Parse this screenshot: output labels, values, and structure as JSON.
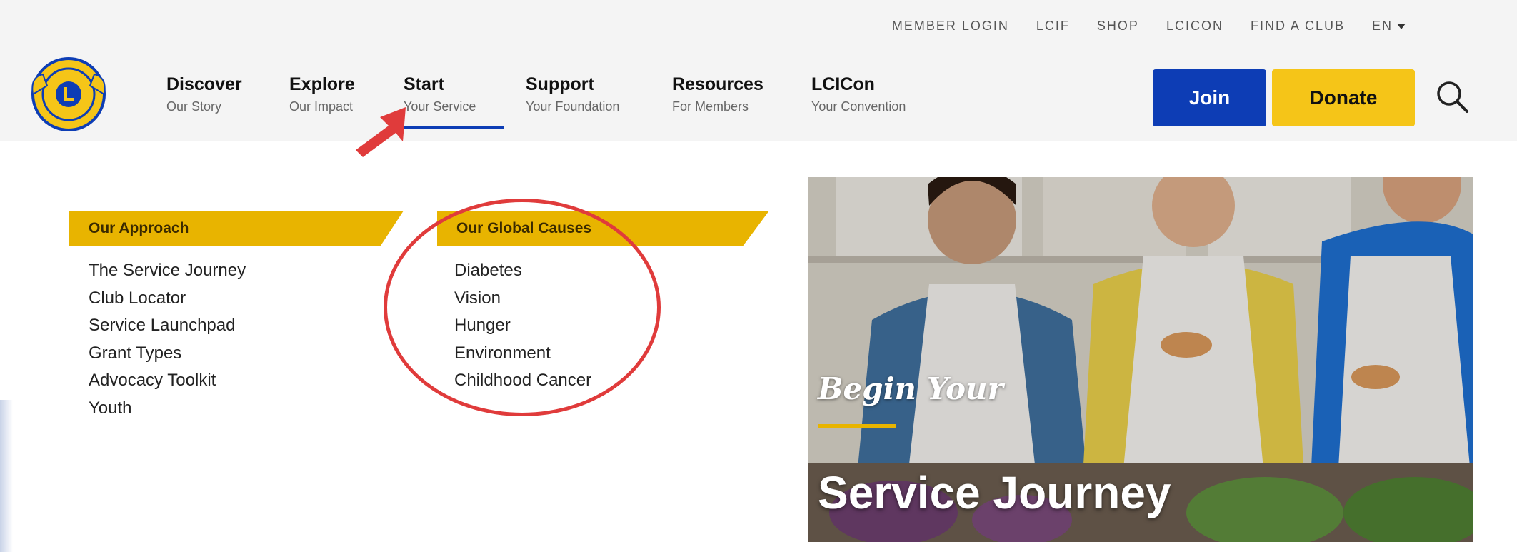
{
  "utility_nav": {
    "items": [
      "MEMBER LOGIN",
      "LCIF",
      "SHOP",
      "LCICON",
      "FIND A CLUB"
    ],
    "language": "EN"
  },
  "main_nav": [
    {
      "title": "Discover",
      "subtitle": "Our Story"
    },
    {
      "title": "Explore",
      "subtitle": "Our Impact"
    },
    {
      "title": "Start",
      "subtitle": "Your Service"
    },
    {
      "title": "Support",
      "subtitle": "Your Foundation"
    },
    {
      "title": "Resources",
      "subtitle": "For Members"
    },
    {
      "title": "LCICon",
      "subtitle": "Your Convention"
    }
  ],
  "actions": {
    "join": "Join",
    "donate": "Donate"
  },
  "colors": {
    "brand_blue": "#0d3db5",
    "brand_gold": "#f5c518",
    "banner_gold": "#e8b400",
    "annotation_red": "#e03b3b"
  },
  "dropdown": {
    "approach": {
      "heading": "Our Approach",
      "items": [
        "The Service Journey",
        "Club Locator",
        "Service Launchpad",
        "Grant Types",
        "Advocacy Toolkit",
        "Youth"
      ]
    },
    "causes": {
      "heading": "Our Global Causes",
      "items": [
        "Diabetes",
        "Vision",
        "Hunger",
        "Environment",
        "Childhood Cancer"
      ]
    }
  },
  "promo": {
    "kicker": "Begin Your",
    "title": "Service Journey"
  }
}
